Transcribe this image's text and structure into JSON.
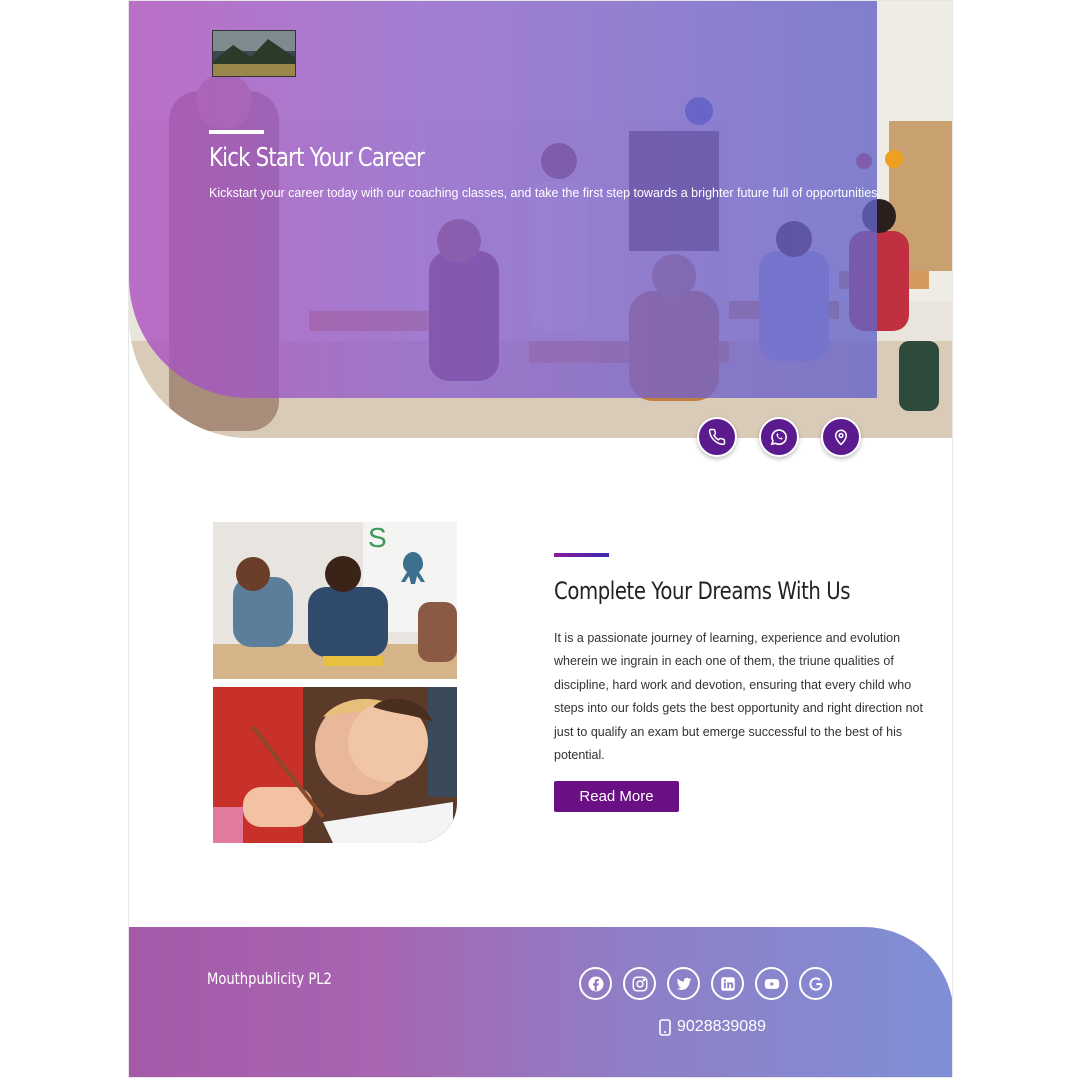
{
  "hero": {
    "title": "Kick Start Your Career",
    "subtitle": "Kickstart your career today with our coaching classes, and take the first step towards a brighter future full of opportunities.",
    "contact_icons": [
      "phone-icon",
      "whatsapp-icon",
      "location-pin-icon"
    ]
  },
  "about": {
    "title": "Complete Your Dreams With Us",
    "text": "It is a passionate journey of learning, experience and evolution wherein we ingrain in each one of them, the triune qualities of discipline, hard work and devotion, ensuring that every child who steps into our folds gets the best opportunity and right direction not just to qualify an exam but emerge successful to the best of his potential.",
    "read_more_label": "Read More"
  },
  "footer": {
    "brand": "Mouthpublicity PL2",
    "social_icons": [
      "facebook-icon",
      "instagram-icon",
      "twitter-icon",
      "linkedin-icon",
      "youtube-icon",
      "google-icon"
    ],
    "phone": "9028839089"
  },
  "colors": {
    "accent_purple": "#6a0f84",
    "circle_purple": "#5b1a8e",
    "footer_gradient_start": "#a45aa8",
    "footer_gradient_end": "#7f8fd6"
  }
}
